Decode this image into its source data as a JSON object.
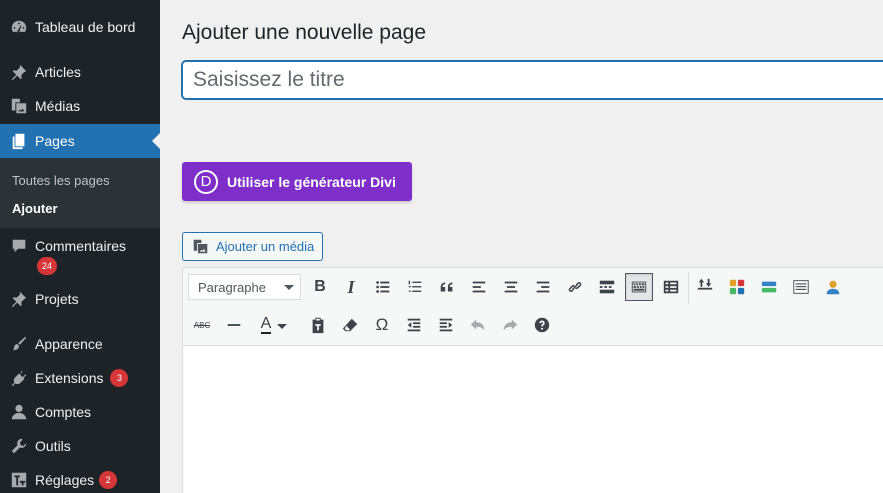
{
  "sidebar": {
    "items": [
      {
        "label": "Tableau de bord",
        "icon": "dashboard-icon"
      },
      {
        "label": "Articles",
        "icon": "pin-icon"
      },
      {
        "label": "Médias",
        "icon": "media-icon"
      },
      {
        "label": "Pages",
        "icon": "pages-icon",
        "active": true
      },
      {
        "label": "Commentaires",
        "icon": "comment-icon",
        "badge": "24"
      },
      {
        "label": "Projets",
        "icon": "pin-icon"
      },
      {
        "label": "Apparence",
        "icon": "brush-icon"
      },
      {
        "label": "Extensions",
        "icon": "plugin-icon",
        "badge": "3"
      },
      {
        "label": "Comptes",
        "icon": "user-icon"
      },
      {
        "label": "Outils",
        "icon": "wrench-icon"
      },
      {
        "label": "Réglages",
        "icon": "settings-icon",
        "badge": "2"
      }
    ],
    "submenu": [
      "Toutes les pages",
      "Ajouter"
    ]
  },
  "main": {
    "heading": "Ajouter une nouvelle page",
    "title_placeholder": "Saisissez le titre",
    "divi_button": "Utiliser le générateur Divi",
    "divi_logo": "D",
    "media_button": "Ajouter un média"
  },
  "editor": {
    "format_value": "Paragraphe",
    "row1_icons": [
      "bold-icon",
      "italic-icon",
      "bullet-list-icon",
      "numbered-list-icon",
      "blockquote-icon",
      "align-left-icon",
      "align-center-icon",
      "align-right-icon",
      "link-icon",
      "read-more-icon",
      "toolbar-toggle-icon",
      "table-icon",
      "divi-layout-icon",
      "color-modules-icon",
      "divi-library-icon",
      "text-block-icon",
      "user-block-icon"
    ],
    "row2_icons": [
      "strikethrough-icon",
      "horizontal-line-icon",
      "text-color-icon",
      "paste-text-icon",
      "clear-format-icon",
      "special-char-icon",
      "outdent-icon",
      "indent-icon",
      "undo-icon",
      "redo-icon",
      "help-icon"
    ],
    "glyphs": {
      "bold": "B",
      "italic": "I",
      "omega": "Ω",
      "text_color": "A",
      "strike": "ABC"
    }
  },
  "colors": {
    "sidebar": "#1d2327",
    "active": "#2271b1",
    "divi": "#7e2ec9",
    "badge": "#d63638"
  }
}
